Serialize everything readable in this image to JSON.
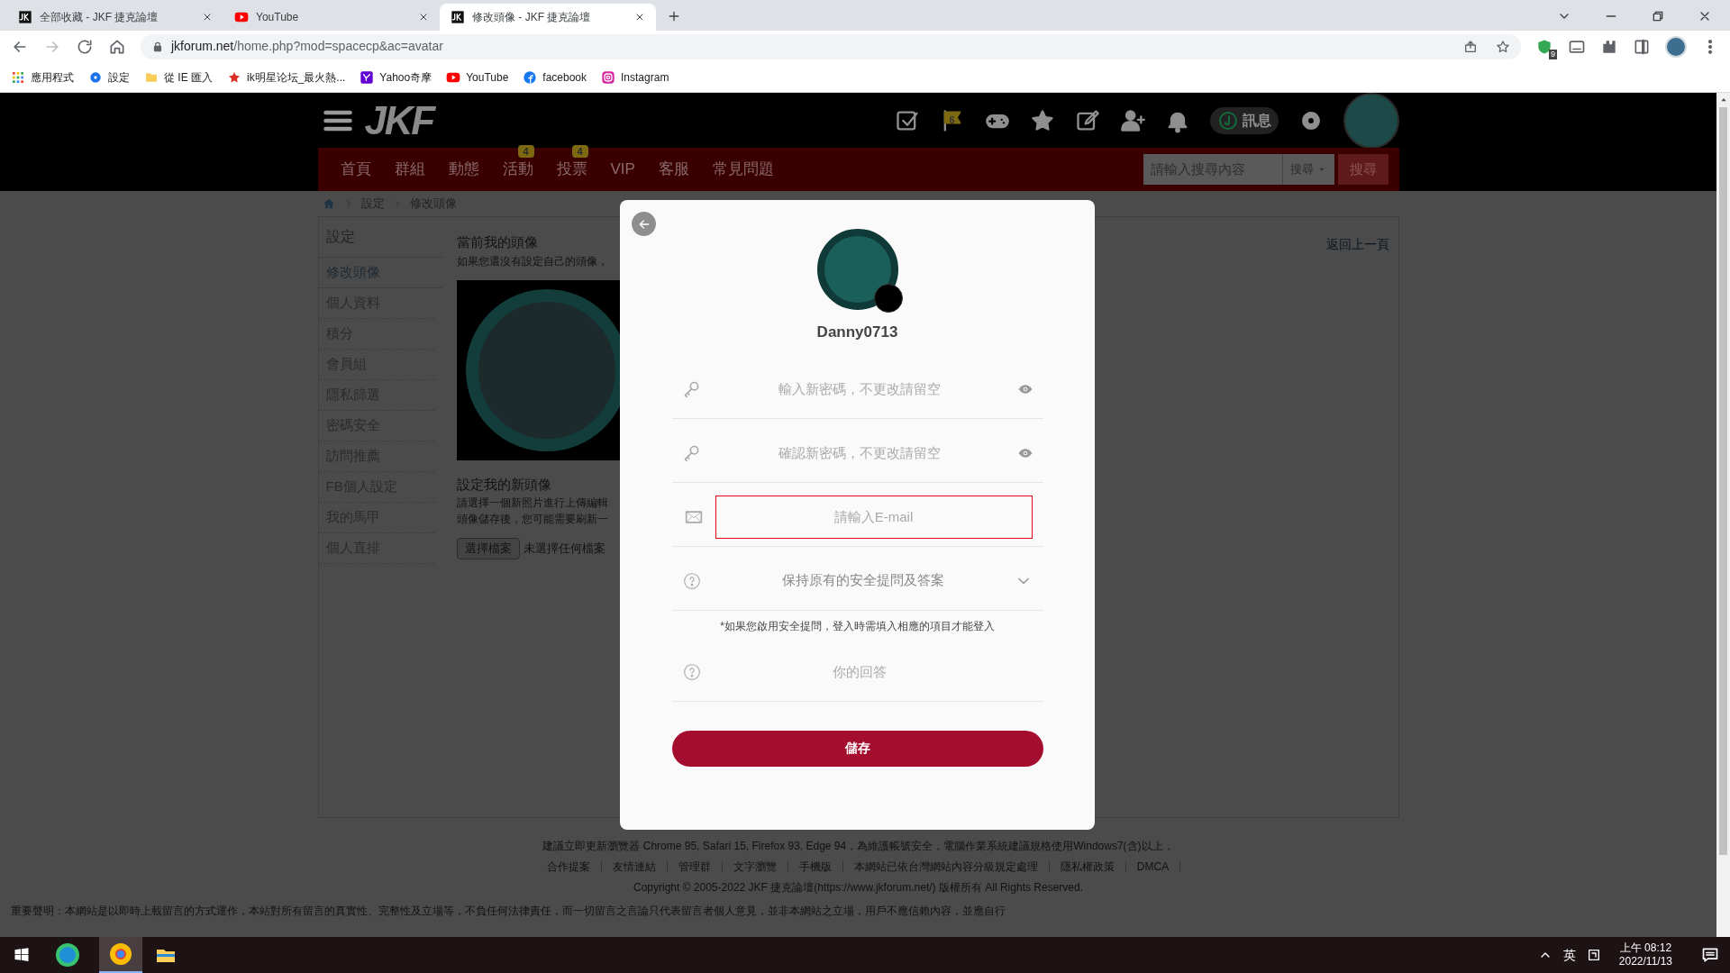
{
  "browser": {
    "tabs": [
      {
        "title": "全部收藏 - JKF 捷克論壇",
        "kind": "jkf",
        "selected": false
      },
      {
        "title": "YouTube",
        "kind": "youtube",
        "selected": false
      },
      {
        "title": "修改頭像 - JKF 捷克論壇",
        "kind": "jkf",
        "selected": true
      }
    ],
    "url_domain": "jkforum.net",
    "url_path": "/home.php?mod=spacecp&ac=avatar",
    "extension_badge": "9",
    "bookmarks": [
      {
        "label": "應用程式",
        "kind": "apps"
      },
      {
        "label": "設定",
        "kind": "gear"
      },
      {
        "label": "從 IE 匯入",
        "kind": "folder"
      },
      {
        "label": "ik明星论坛_最火熱...",
        "kind": "star"
      },
      {
        "label": "Yahoo奇摩",
        "kind": "yahoo"
      },
      {
        "label": "YouTube",
        "kind": "youtube"
      },
      {
        "label": "facebook",
        "kind": "facebook"
      },
      {
        "label": "Instagram",
        "kind": "instagram"
      }
    ]
  },
  "site": {
    "logo": "JKF",
    "flag_count": "6",
    "messages": "訊息",
    "nav": [
      {
        "label": "首頁"
      },
      {
        "label": "群組"
      },
      {
        "label": "動態"
      },
      {
        "label": "活動",
        "badge": "4"
      },
      {
        "label": "投票",
        "badge": "4"
      },
      {
        "label": "VIP"
      },
      {
        "label": "客服"
      },
      {
        "label": "常見問題"
      }
    ],
    "search": {
      "placeholder": "請輸入搜尋內容",
      "scope": "搜尋",
      "button": "搜尋"
    },
    "breadcrumb": [
      "設定",
      "修改頭像"
    ],
    "sidebar": {
      "title": "設定",
      "items": [
        {
          "label": "修改頭像",
          "selected": true
        },
        {
          "label": "個人資料",
          "selected": false
        },
        {
          "label": "積分",
          "selected": false
        },
        {
          "label": "會員組",
          "selected": false
        },
        {
          "label": "隱私篩選",
          "selected": false
        },
        {
          "label": "密碼安全",
          "selected": false
        },
        {
          "label": "訪問推薦",
          "selected": false
        },
        {
          "label": "FB個人設定",
          "selected": false
        },
        {
          "label": "我的馬甲",
          "selected": false
        },
        {
          "label": "個人直排",
          "selected": false
        }
      ]
    },
    "content": {
      "current_title": "當前我的頭像",
      "current_desc": "如果您還沒有設定自己的頭像，",
      "new_title": "設定我的新頭像",
      "new_desc": [
        "請選擇一個新照片進行上傳編輯",
        "頭像儲存後，您可能需要刷新一"
      ],
      "file_button": "選擇檔案",
      "file_status": "未選擇任何檔案",
      "back_link": "返回上一頁"
    },
    "footer": {
      "notice": "建議立即更新瀏覽器 Chrome 95, Safari 15, Firefox 93, Edge 94，為維護帳號安全，電腦作業系統建議規格使用Windows7(含)以上，",
      "links": [
        "合作提案",
        "友情連結",
        "管理群",
        "文字瀏覽",
        "手機版",
        "本網站已依台灣網站內容分級規定處理",
        "隱私權政策",
        "DMCA"
      ],
      "copyright": "Copyright © 2005-2022 JKF 捷克論壇(https://www.jkforum.net/) 版權所有 All Rights Reserved.",
      "disclaimer": "重要聲明：本網站是以即時上載留言的方式運作，本站對所有留言的真實性、完整性及立場等，不負任何法律責任，而一切留言之言論只代表留言者個人意見，並非本網站之立場，用戶不應信賴內容，並應自行"
    }
  },
  "modal": {
    "username": "Danny0713",
    "fields": [
      {
        "kind": "password",
        "placeholder": "輸入新密碼，不更改請留空",
        "focused": false
      },
      {
        "kind": "password",
        "placeholder": "確認新密碼，不更改請留空",
        "focused": false
      },
      {
        "kind": "email",
        "placeholder": "請輸入E-mail",
        "focused": true
      },
      {
        "kind": "select",
        "value": "保持原有的安全提問及答案",
        "focused": false
      },
      {
        "kind": "answer",
        "placeholder": "你的回答",
        "focused": false
      }
    ],
    "note": "*如果您啟用安全提問，登入時需填入相應的項目才能登入",
    "save_button": "儲存"
  },
  "taskbar": {
    "ime": "英",
    "time": "上午 08:12",
    "date": "2022/11/13"
  }
}
